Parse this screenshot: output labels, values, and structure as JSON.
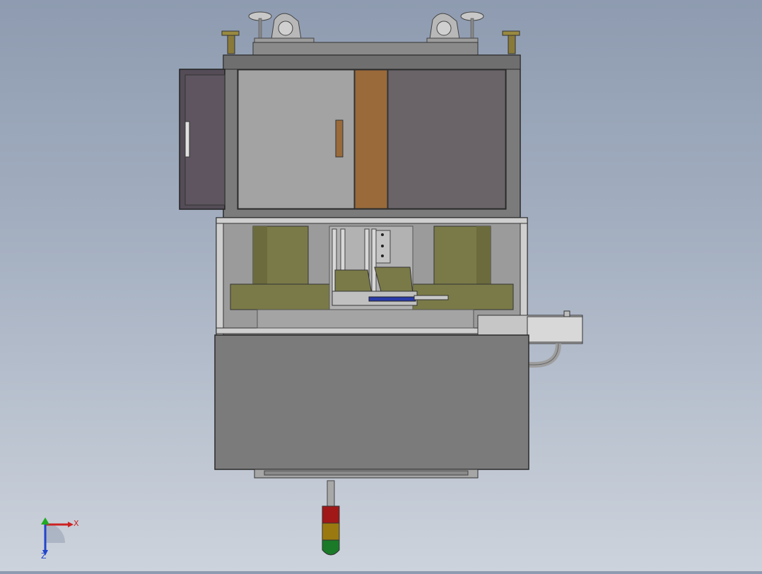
{
  "viewport": {
    "background_top": "#8e9bb0",
    "background_bottom": "#cdd3dc"
  },
  "colors": {
    "frame": "#7b7b7b",
    "panel_light": "#a3a3a3",
    "panel_dark": "#6a6469",
    "panel_brown": "#9a6a3a",
    "drawer": "#544c56",
    "rollers": "#7a7a48",
    "beacon_red": "#a01818",
    "beacon_amber": "#9a7a10",
    "beacon_green": "#1a7a28"
  },
  "orientation_triad": {
    "x_label": "X",
    "z_label": "Z",
    "x_color": "#cc2222",
    "y_color": "#22aa22",
    "z_color": "#2244cc"
  }
}
